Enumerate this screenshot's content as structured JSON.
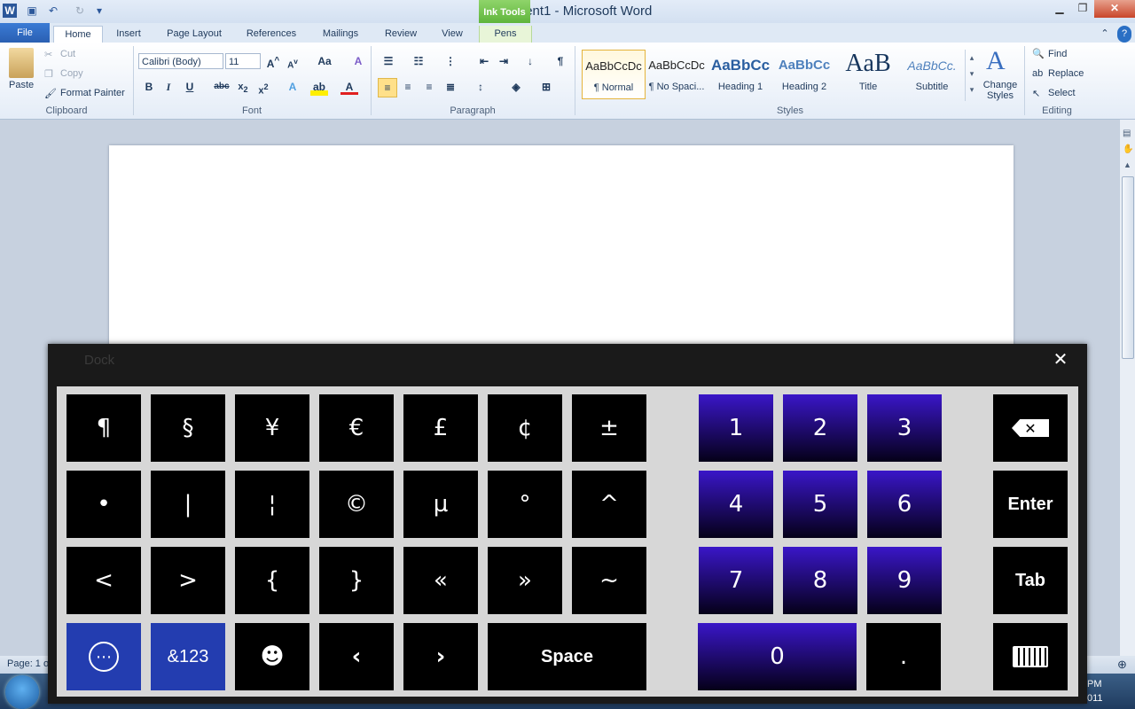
{
  "window": {
    "title": "Document1  -  Microsoft Word",
    "contextual_tab_group": "Ink Tools"
  },
  "tabs": [
    "File",
    "Home",
    "Insert",
    "Page Layout",
    "References",
    "Mailings",
    "Review",
    "View",
    "Pens"
  ],
  "clipboard": {
    "paste": "Paste",
    "cut": "Cut",
    "copy": "Copy",
    "format_painter": "Format Painter",
    "group_label": "Clipboard"
  },
  "font": {
    "name": "Calibri (Body)",
    "size": "11",
    "change_case": "Aa",
    "group_label": "Font"
  },
  "paragraph": {
    "group_label": "Paragraph"
  },
  "styles": {
    "items": [
      {
        "sample": "AaBbCcDc",
        "name": "¶ Normal"
      },
      {
        "sample": "AaBbCcDc",
        "name": "¶ No Spaci..."
      },
      {
        "sample": "AaBbCc",
        "name": "Heading 1"
      },
      {
        "sample": "AaBbCc",
        "name": "Heading 2"
      },
      {
        "sample": "AaB",
        "name": "Title"
      },
      {
        "sample": "AaBbCc.",
        "name": "Subtitle"
      }
    ],
    "change_styles": "Change Styles",
    "group_label": "Styles"
  },
  "editing": {
    "find": "Find",
    "replace": "Replace",
    "select": "Select",
    "group_label": "Editing"
  },
  "status": {
    "page": "Page: 1 o"
  },
  "taskbar": {
    "time": "PM",
    "date": "011"
  },
  "keyboard": {
    "title": "Dock",
    "close": "✕",
    "symbol_rows": [
      [
        "¶",
        "§",
        "¥",
        "€",
        "£",
        "¢",
        "±"
      ],
      [
        "•",
        "|",
        "¦",
        "©",
        "µ",
        "°",
        "^"
      ],
      [
        "<",
        ">",
        "{",
        "}",
        "«",
        "»",
        "~"
      ]
    ],
    "bottom_row": {
      "more": "⋯",
      "mode": "&123",
      "emoji": "☻",
      "left": "‹",
      "right": "›",
      "space": "Space"
    },
    "numpad": [
      "1",
      "2",
      "3",
      "4",
      "5",
      "6",
      "7",
      "8",
      "9"
    ],
    "zero": "0",
    "dot": ".",
    "right_keys": {
      "backspace": "⌫",
      "enter": "Enter",
      "tab": "Tab",
      "keyboard": "⌨"
    }
  }
}
